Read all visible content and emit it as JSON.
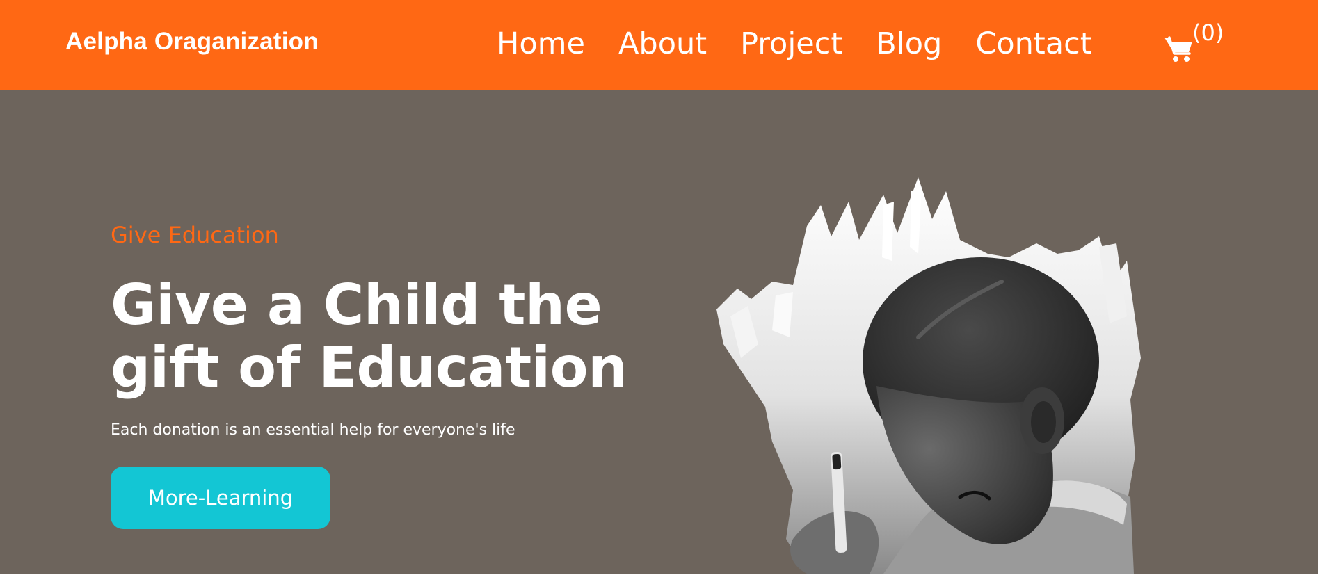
{
  "header": {
    "brand": "Aelpha Oraganization",
    "nav": [
      "Home",
      "About",
      "Project",
      "Blog",
      "Contact"
    ],
    "cart_count": "(0)",
    "cart_icon": "cart-icon"
  },
  "hero": {
    "eyebrow": "Give Education",
    "headline_line1": "Give a Child the",
    "headline_line2": "gift of Education",
    "subline": "Each donation is an essential help for everyone's life",
    "cta_label": "More-Learning"
  },
  "colors": {
    "header_bg": "#ff6814",
    "hero_bg": "#6d645c",
    "accent": "#ff6814",
    "button_bg": "#13c6d4",
    "text": "#ffffff"
  }
}
